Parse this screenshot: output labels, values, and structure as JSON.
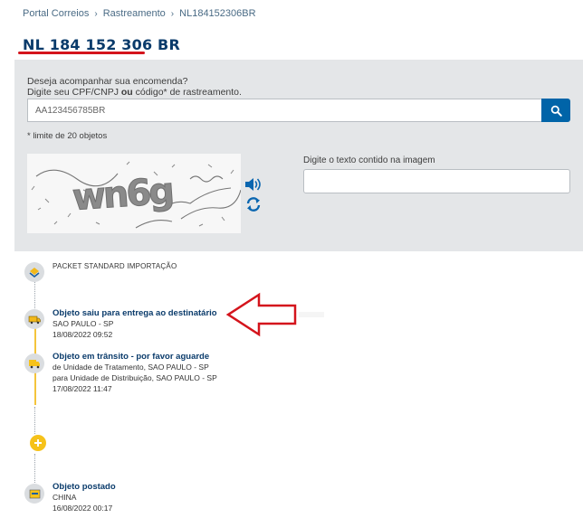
{
  "breadcrumb": {
    "items": [
      "Portal Correios",
      "Rastreamento",
      "NL184152306BR"
    ],
    "separator": "›"
  },
  "tracking_code": "NL 184 152 306 BR",
  "search": {
    "prompt_line1": "Deseja acompanhar sua encomenda?",
    "prompt_line2_a": "Digite seu CPF/CNPJ ",
    "prompt_line2_b": "ou",
    "prompt_line2_c": " código* de rastreamento.",
    "input_value": "AA123456785BR",
    "limit_note": "* limite de 20 objetos",
    "captcha_text": "wn6g",
    "captcha_label": "Digite o texto contido na imagem",
    "captcha_value": ""
  },
  "timeline": {
    "header": "PACKET STANDARD IMPORTAÇÃO",
    "events": [
      {
        "title": "Objeto saiu para entrega ao destinatário",
        "lines": [
          "SAO PAULO - SP",
          "18/08/2022 09:52"
        ]
      },
      {
        "title": "Objeto em trânsito - por favor aguarde",
        "lines": [
          "de Unidade de Tratamento, SAO PAULO - SP",
          "para Unidade de Distribuição, SAO PAULO - SP",
          "17/08/2022 11:47"
        ]
      },
      {
        "title": "Objeto postado",
        "lines": [
          "CHINA",
          "16/08/2022 00:17"
        ]
      }
    ]
  },
  "colors": {
    "brand_blue": "#0a3b6b",
    "button_blue": "#0064a8",
    "accent_yellow": "#f6c21a",
    "annotation_red": "#d4141c"
  },
  "icons": {
    "search_button": "search-icon",
    "audio": "speaker-icon",
    "refresh": "refresh-icon",
    "expand": "plus-icon"
  }
}
